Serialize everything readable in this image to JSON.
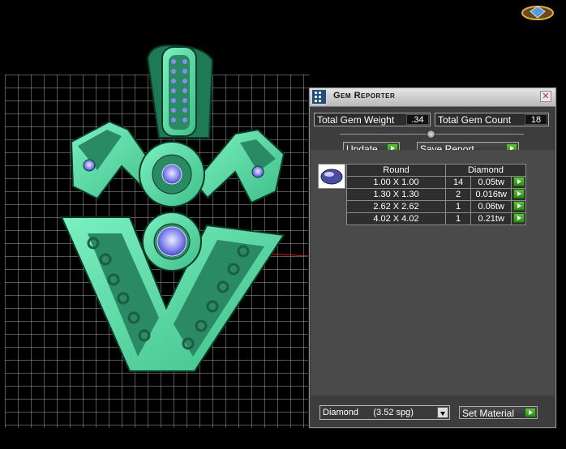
{
  "panel": {
    "title": "Gem Reporter",
    "close_glyph": "✕",
    "stats": {
      "weight_label": "Total Gem Weight",
      "weight_value": ".34",
      "count_label": "Total Gem Count",
      "count_value": "18"
    },
    "buttons": {
      "update_label": "Update",
      "save_report_label": "Save Report",
      "set_material_label": "Set Material"
    },
    "table": {
      "shape_header": "Round",
      "material_header": "Diamond",
      "rows": [
        {
          "size": "1.00 X 1.00",
          "qty": "14",
          "weight": "0.05tw"
        },
        {
          "size": "1.30 X 1.30",
          "qty": "2",
          "weight": "0.016tw"
        },
        {
          "size": "2.62 X 2.62",
          "qty": "1",
          "weight": "0.06tw"
        },
        {
          "size": "4.02 X 4.02",
          "qty": "1",
          "weight": "0.21tw"
        }
      ]
    },
    "material_select": {
      "value": "Diamond      (3.52 spg)"
    }
  },
  "colors": {
    "model_green": "#5ee0a8",
    "grid_line": "#bdbdbd",
    "accent_arrow": "#3aa31f",
    "gem_blue": "#8a8cf0"
  },
  "icons": {
    "title": "gem-reporter-icon",
    "logo": "app-logo-icon",
    "thumb": "oval-gem-icon"
  }
}
